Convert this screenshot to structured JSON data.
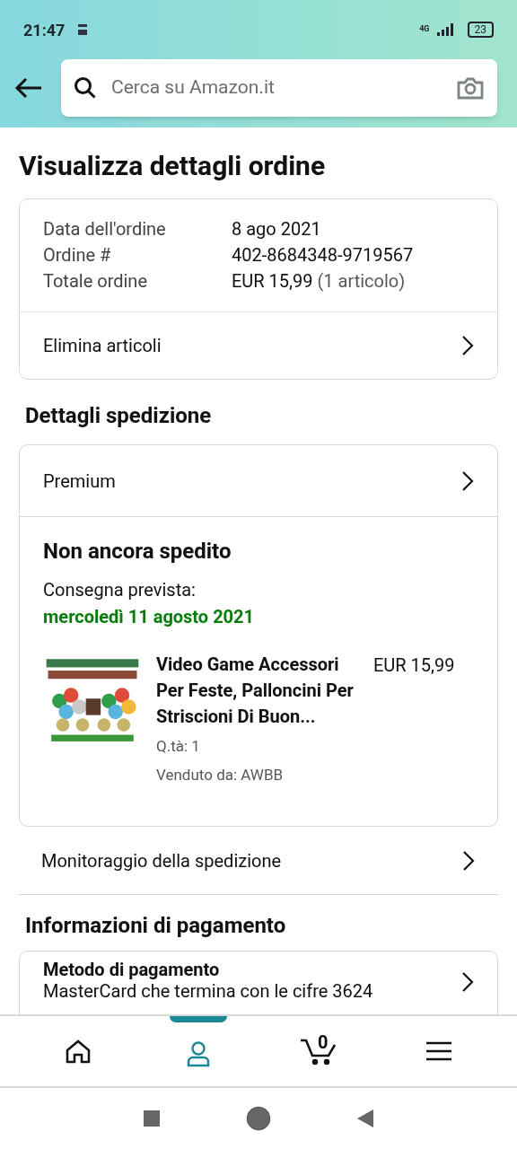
{
  "status_bar": {
    "time": "21:47",
    "network": "4G",
    "battery": "23"
  },
  "search": {
    "placeholder": "Cerca su Amazon.it"
  },
  "title": "Visualizza dettagli ordine",
  "order": {
    "fields": [
      {
        "label": "Data dell'ordine",
        "value": "8 ago 2021"
      },
      {
        "label": "Ordine #",
        "value": "402-8684348-9719567"
      },
      {
        "label": "Totale ordine",
        "value": "EUR 15,99",
        "note": "(1 articolo)"
      }
    ],
    "action": "Elimina articoli"
  },
  "shipping": {
    "heading": "Dettagli spedizione",
    "method": "Premium",
    "status": "Non ancora spedito",
    "delivery_label": "Consegna prevista:",
    "delivery_date": "mercoledì 11 agosto 2021",
    "item": {
      "kind": "picture",
      "name": "Video Game Accessori Per Feste, Palloncini Per Striscioni Di Buon...",
      "price": "EUR 15,99",
      "quantity": "Q.tà: 1",
      "seller": "Venduto da: AWBB"
    },
    "tracking": "Monitoraggio della spedizione"
  },
  "payment": {
    "heading": "Informazioni di pagamento",
    "title": "Metodo di pagamento",
    "detail": "MasterCard che termina con le cifre 3624"
  },
  "bottom_nav": [
    {
      "kind": "home",
      "selected": false
    },
    {
      "kind": "account",
      "selected": true
    },
    {
      "kind": "cart",
      "selected": false,
      "count": "0"
    },
    {
      "kind": "menu",
      "selected": false
    }
  ]
}
